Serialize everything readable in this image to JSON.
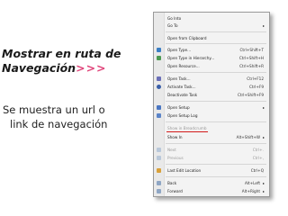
{
  "slide": {
    "title_line1": "Mostrar en ruta de",
    "title_line2": "Navegación",
    "title_chevrons": ">>>",
    "subtitle_line1": "Se muestra un url o",
    "subtitle_line2": "link de navegación"
  },
  "menu": {
    "items": [
      {
        "label": "Go Into",
        "shortcut": "",
        "icon": "",
        "disabled": false
      },
      {
        "label": "Go To",
        "shortcut": "",
        "icon": "",
        "disabled": false,
        "submenu": true
      },
      {
        "label": "Open from Clipboard",
        "shortcut": "",
        "icon": "",
        "disabled": false
      },
      {
        "label": "Open Type...",
        "shortcut": "Ctrl+Shift+T",
        "icon": "type-icon",
        "disabled": false
      },
      {
        "label": "Open Type in Hierarchy...",
        "shortcut": "Ctrl+Shift+H",
        "icon": "hierarchy-icon",
        "disabled": false
      },
      {
        "label": "Open Resource...",
        "shortcut": "Ctrl+Shift+R",
        "icon": "",
        "disabled": false
      },
      {
        "label": "Open Task...",
        "shortcut": "Ctrl+F12",
        "icon": "task-icon",
        "disabled": false
      },
      {
        "label": "Activate Task...",
        "shortcut": "Ctrl+F9",
        "icon": "activate-task-icon",
        "disabled": false
      },
      {
        "label": "Deactivate Task",
        "shortcut": "Ctrl+Shift+F9",
        "icon": "",
        "disabled": false
      },
      {
        "label": "Open Setup",
        "shortcut": "",
        "icon": "setup-icon",
        "disabled": false,
        "submenu": true
      },
      {
        "label": "Open Setup Log",
        "shortcut": "",
        "icon": "setup-log-icon",
        "disabled": false
      },
      {
        "label": "Show in Breadcrumb",
        "shortcut": "",
        "icon": "",
        "disabled": true
      },
      {
        "label": "Show In",
        "shortcut": "Alt+Shift+W",
        "icon": "",
        "disabled": false,
        "submenu": true
      },
      {
        "label": "Next",
        "shortcut": "Ctrl+.",
        "icon": "next-icon",
        "disabled": true
      },
      {
        "label": "Previous",
        "shortcut": "Ctrl+,",
        "icon": "previous-icon",
        "disabled": true
      },
      {
        "label": "Last Edit Location",
        "shortcut": "Ctrl+Q",
        "icon": "last-edit-icon",
        "disabled": false
      },
      {
        "label": "Back",
        "shortcut": "Alt+Left",
        "icon": "back-icon",
        "disabled": false,
        "submenu": true
      },
      {
        "label": "Forward",
        "shortcut": "Alt+Right",
        "icon": "forward-icon",
        "disabled": false,
        "submenu": true
      }
    ]
  },
  "colors": {
    "accent_chevrons": "#e0447a",
    "underline": "#d21a1a"
  }
}
